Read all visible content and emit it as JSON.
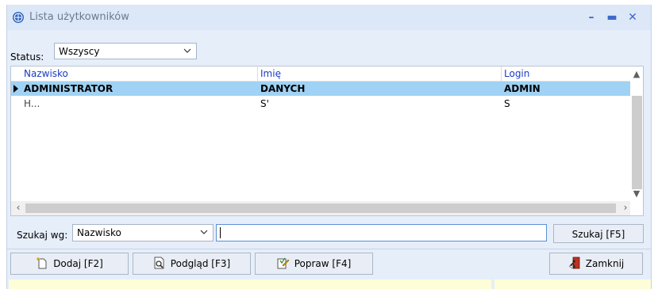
{
  "window": {
    "title": "Lista użytkowników"
  },
  "status_filter": {
    "label": "Status:",
    "selected": "Wszyscy"
  },
  "grid": {
    "columns": [
      "Nazwisko",
      "Imię",
      "Login"
    ],
    "rows": [
      {
        "nazwisko": "ADMINISTRATOR",
        "imie": "DANYCH",
        "login": "ADMIN",
        "selected": true
      },
      {
        "nazwisko": "H...",
        "imie": "S'",
        "login": "S",
        "selected": false
      }
    ]
  },
  "search": {
    "label": "Szukaj wg:",
    "field_selected": "Nazwisko",
    "query": "",
    "button_label": "Szukaj [F5]"
  },
  "toolbar": {
    "add_label": "Dodaj [F2]",
    "preview_label": "Podgląd [F3]",
    "edit_label": "Popraw [F4]",
    "close_label": "Zamknij"
  },
  "colors": {
    "selected_row": "#9fd2f4",
    "header_text": "#1a3cc6",
    "window_bg": "#e6eefa"
  }
}
